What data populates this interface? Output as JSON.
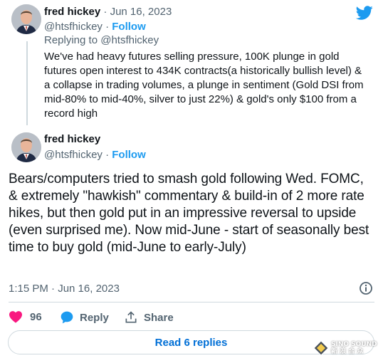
{
  "parent_tweet": {
    "author_name": "fred hickey",
    "separator": "·",
    "date": "Jun 16, 2023",
    "handle": "@htsfhickey",
    "handle_follow_separator": "·",
    "follow_label": "Follow",
    "replying_to_prefix": "Replying to",
    "replying_to_handle": "@htsfhickey",
    "text": "We've had heavy futures selling pressure, 100K plunge in gold futures open interest to 434K contracts(a historically bullish level) & a collapse in trading volumes, a plunge in sentiment (Gold DSI from mid-80% to mid-40%, silver to just 22%) & gold's only $100 from a record high"
  },
  "main_tweet": {
    "author_name": "fred hickey",
    "handle": "@htsfhickey",
    "handle_follow_separator": "·",
    "follow_label": "Follow",
    "text": "Bears/computers tried to smash gold following Wed. FOMC, & extremely \"hawkish\" commentary & build-in of 2 more rate hikes, but then gold put in an impressive reversal to upside (even surprised me). Now mid-June - start of seasonally best time to buy gold (mid-June to early-July)",
    "timestamp": "1:15 PM · Jun 16, 2023"
  },
  "actions": {
    "like_count": "96",
    "reply_label": "Reply",
    "share_label": "Share"
  },
  "read_replies_label": "Read 6 replies",
  "watermark": {
    "line1": "SINO SOUND",
    "line2": "新 浪 合 众"
  },
  "colors": {
    "brand_blue": "#1d9bf0",
    "link_blue": "#006fd6",
    "like_red": "#f91880",
    "muted_text": "#536471",
    "border": "#cfd9de"
  },
  "icons": {
    "brand": "twitter-bird-icon",
    "info": "info-icon",
    "like": "heart-icon",
    "reply": "speech-bubble-icon",
    "share": "share-upload-icon"
  }
}
